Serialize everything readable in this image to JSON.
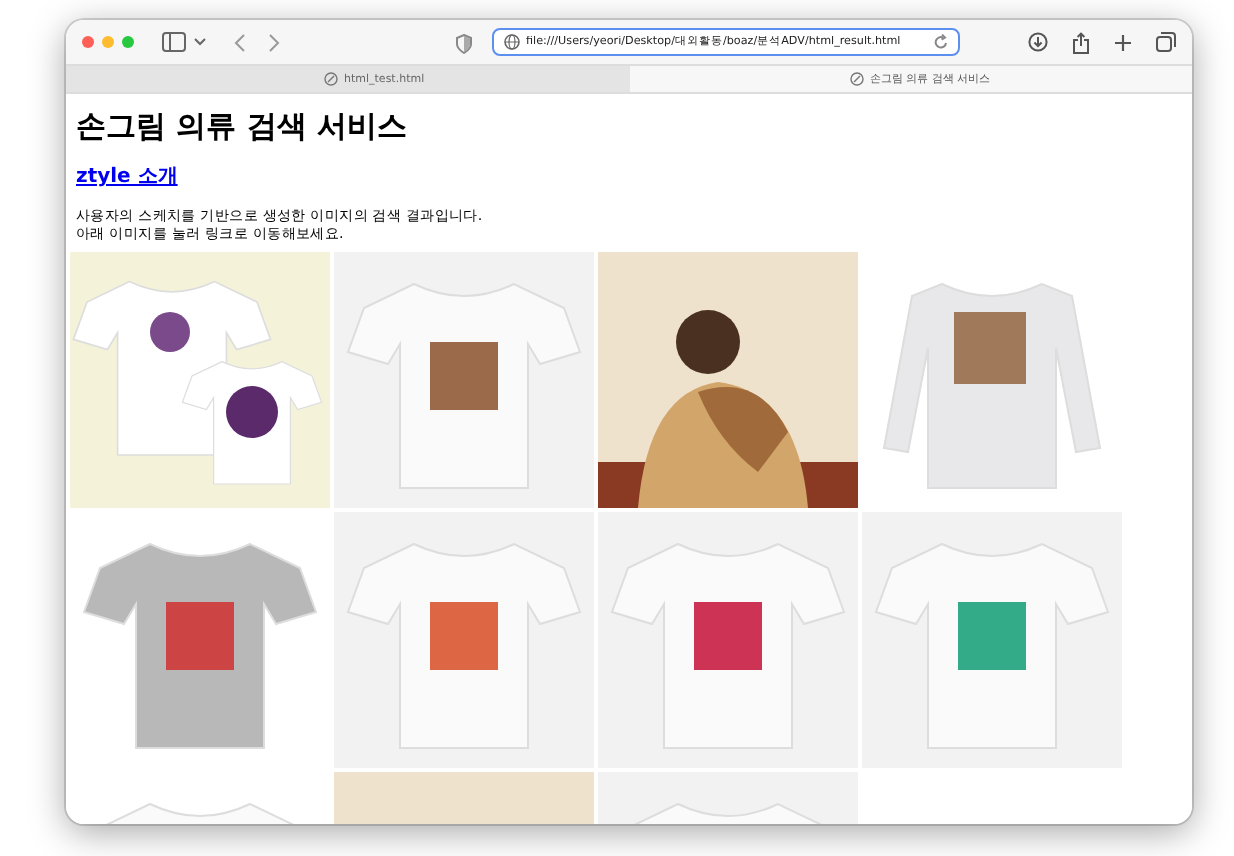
{
  "browser": {
    "address": "file:///Users/yeori/Desktop/대외활동/boaz/분석ADV/html_result.html",
    "tabs": [
      {
        "label": "html_test.html",
        "selected": false
      },
      {
        "label": "손그림 의류 검색 서비스",
        "selected": true
      }
    ]
  },
  "page": {
    "heading": "손그림 의류 검색 서비스",
    "link": "ztyle 소개",
    "paragraph": [
      "사용자의 스케치를 기반으로 생성한 이미지의 검색 결과입니다.",
      "아래 이미지를 눌러 링크로 이동해보세요."
    ],
    "images": [
      {
        "kind": "tshirt-pair"
      },
      {
        "kind": "tshirt"
      },
      {
        "kind": "illustration"
      },
      {
        "kind": "longsleeve"
      },
      {
        "kind": "tshirt"
      },
      {
        "kind": "tshirt"
      },
      {
        "kind": "tshirt"
      },
      {
        "kind": "tshirt"
      },
      {
        "kind": "tshirt"
      },
      {
        "kind": "illustration"
      },
      {
        "kind": "tshirt"
      }
    ]
  }
}
